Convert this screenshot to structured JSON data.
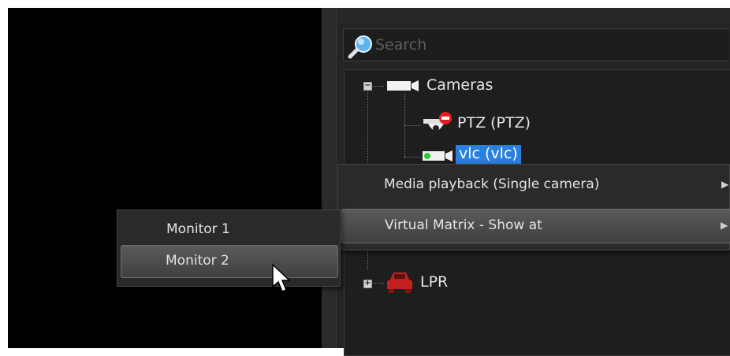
{
  "search": {
    "placeholder": "Search"
  },
  "tree": {
    "root_label": "Cameras",
    "items": [
      {
        "label": "PTZ (PTZ)",
        "icon": "ptz-camera-error-icon"
      },
      {
        "label": "vlc (vlc)",
        "icon": "camera-online-icon",
        "selected": true
      }
    ],
    "group_lpr": {
      "label": "LPR",
      "icon": "car-icon",
      "expander": "+"
    },
    "root_expander": "−"
  },
  "context_menu": {
    "items": [
      {
        "label": "Media playback (Single camera)",
        "has_submenu": true
      },
      {
        "label": "Virtual Matrix - Show at",
        "has_submenu": true,
        "highlighted": true
      }
    ]
  },
  "submenu": {
    "items": [
      {
        "label": "Monitor 1"
      },
      {
        "label": "Monitor 2",
        "highlighted": true
      }
    ]
  },
  "colors": {
    "selection": "#2a7fe0",
    "video_background": "#000000",
    "panel_background": "#242424"
  }
}
